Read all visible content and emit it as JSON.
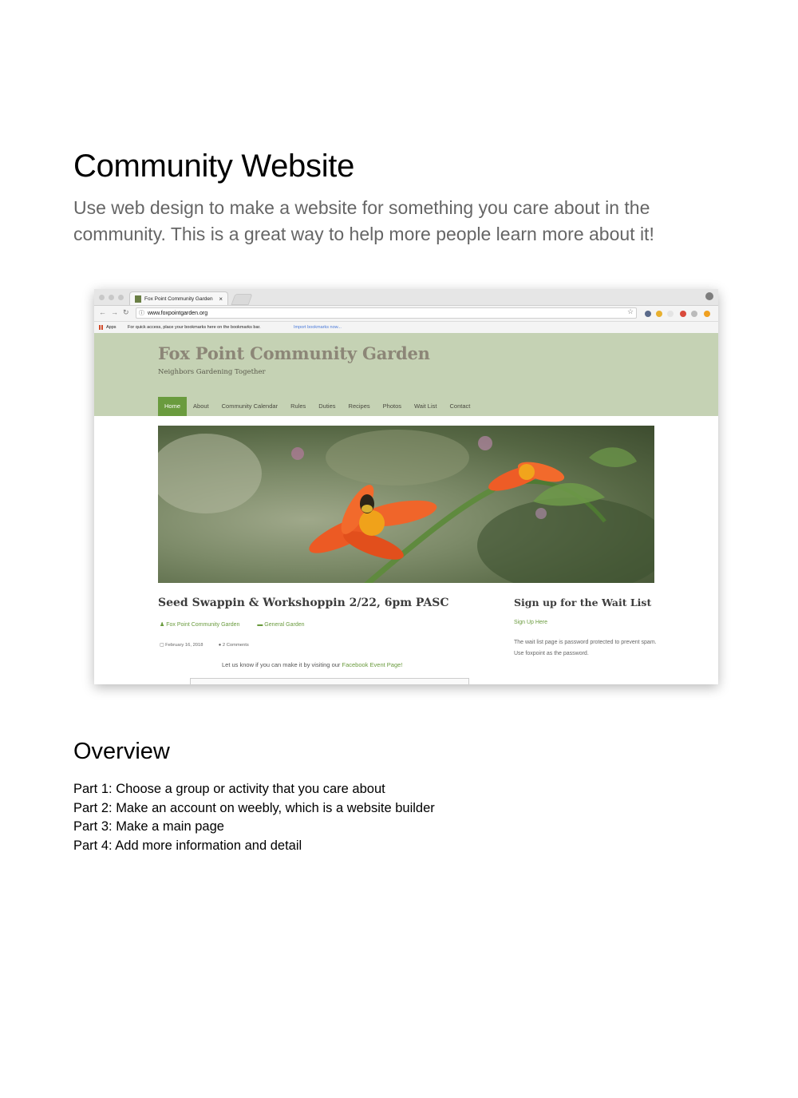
{
  "document": {
    "title": "Community Website",
    "subtitle": "Use web design to make a website for something you care about in the community. This is a great way to help more people learn more about it!"
  },
  "browser": {
    "tab_title": "Fox Point Community Garden",
    "tab_close": "×",
    "url": "www.foxpointgarden.org",
    "bookmarks_apps": "Apps",
    "bookmarks_hint": "For quick access, place your bookmarks here on the bookmarks bar.",
    "bookmarks_import": "Import bookmarks now..."
  },
  "site": {
    "title": "Fox Point Community Garden",
    "tagline": "Neighbors Gardening Together",
    "nav": [
      "Home",
      "About",
      "Community Calendar",
      "Rules",
      "Duties",
      "Recipes",
      "Photos",
      "Wait List",
      "Contact"
    ],
    "post": {
      "title": "Seed Swappin & Workshoppin 2/22, 6pm PASC",
      "author": "Fox Point Community Garden",
      "category": "General Garden",
      "date": "February 16, 2018",
      "comments": "2 Comments",
      "body_prefix": "Let us know if you can make it by visiting our ",
      "body_link": "Facebook Event Page!"
    },
    "sidebar": {
      "title": "Sign up for the Wait List",
      "link": "Sign Up Here",
      "text": "The wait list page is password protected to prevent spam. Use foxpoint as the password."
    }
  },
  "overview": {
    "title": "Overview",
    "items": [
      "Part 1: Choose a group or activity that you care about",
      "Part 2: Make an account on weebly, which is a website builder",
      "Part 3: Make a main page",
      "Part 4: Add more information and detail"
    ]
  }
}
